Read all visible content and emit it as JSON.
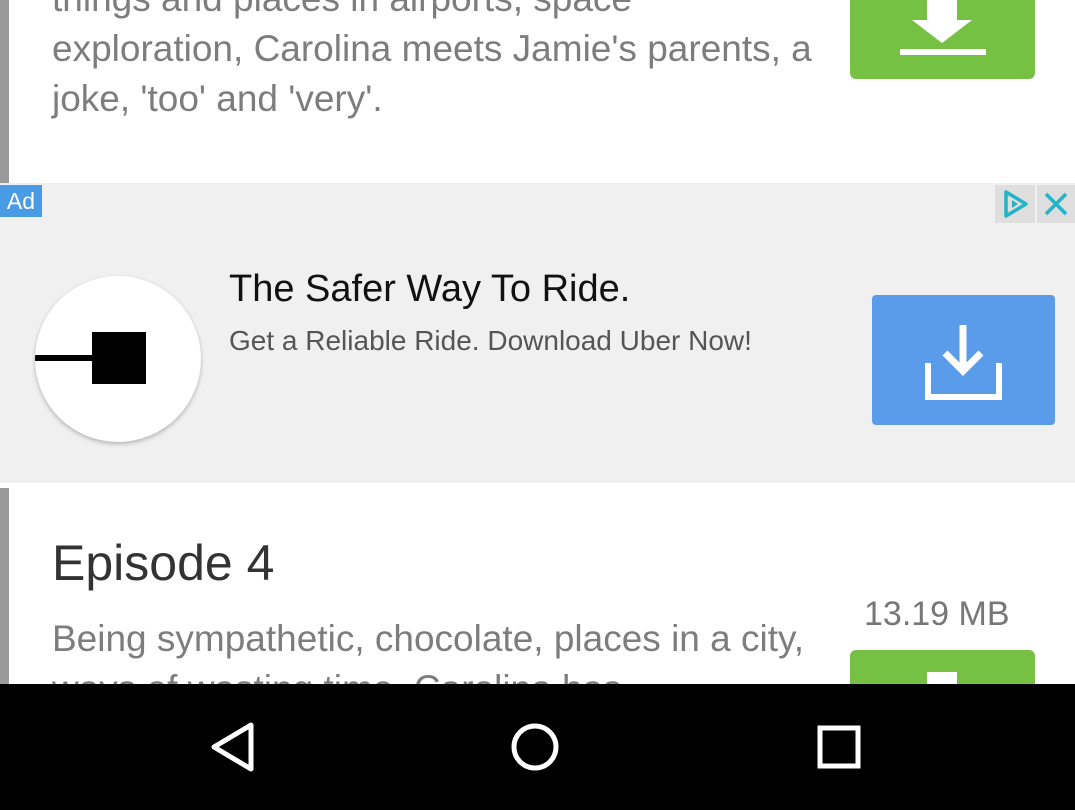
{
  "episode_prev": {
    "description": "things and places in airports, space exploration, Carolina meets Jamie's parents, a joke, 'too' and 'very'.",
    "download_icon": "download-arrow-icon",
    "download_color": "#76c043"
  },
  "ad": {
    "badge": "Ad",
    "title": "The Safer Way To Ride.",
    "subtitle": "Get a Reliable Ride. Download Uber Now!",
    "choices_icon": "adchoices-icon",
    "close_icon": "close-icon",
    "logo_icon": "uber-logo-icon",
    "download_icon": "download-tray-icon",
    "download_color": "#5a9bea"
  },
  "episode_4": {
    "title": "Episode 4",
    "description": "Being sympathetic, chocolate, places in a city, ways of wasting time, Carolina has",
    "size": "13.19 MB",
    "download_icon": "download-arrow-icon",
    "download_color": "#76c043"
  },
  "navbar": {
    "back_icon": "back-triangle-icon",
    "home_icon": "home-circle-icon",
    "recents_icon": "recents-square-icon"
  }
}
